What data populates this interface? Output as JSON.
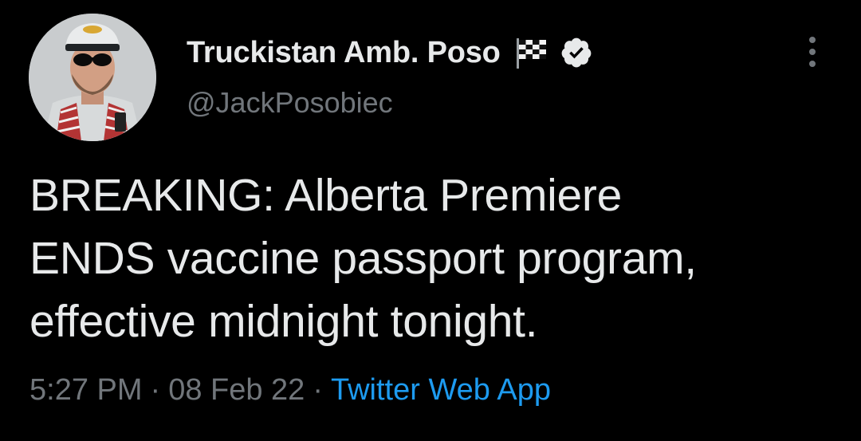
{
  "author": {
    "display_name": "Truckistan Amb. Poso",
    "handle": "@JackPosobiec",
    "flag_emoji_icon": "checkered-flag-icon",
    "verified_icon": "verified-badge-icon"
  },
  "tweet": {
    "text": "BREAKING: Alberta Premiere\nENDS vaccine passport program,\neffective midnight tonight."
  },
  "meta": {
    "time": "5:27 PM",
    "separator": "·",
    "date": "08 Feb 22",
    "source": "Twitter Web App"
  },
  "colors": {
    "background": "#000000",
    "text_primary": "#e7e9ea",
    "text_secondary": "#71767b",
    "link": "#1d9bf0"
  },
  "icons": {
    "more": "more-vertical-icon"
  }
}
